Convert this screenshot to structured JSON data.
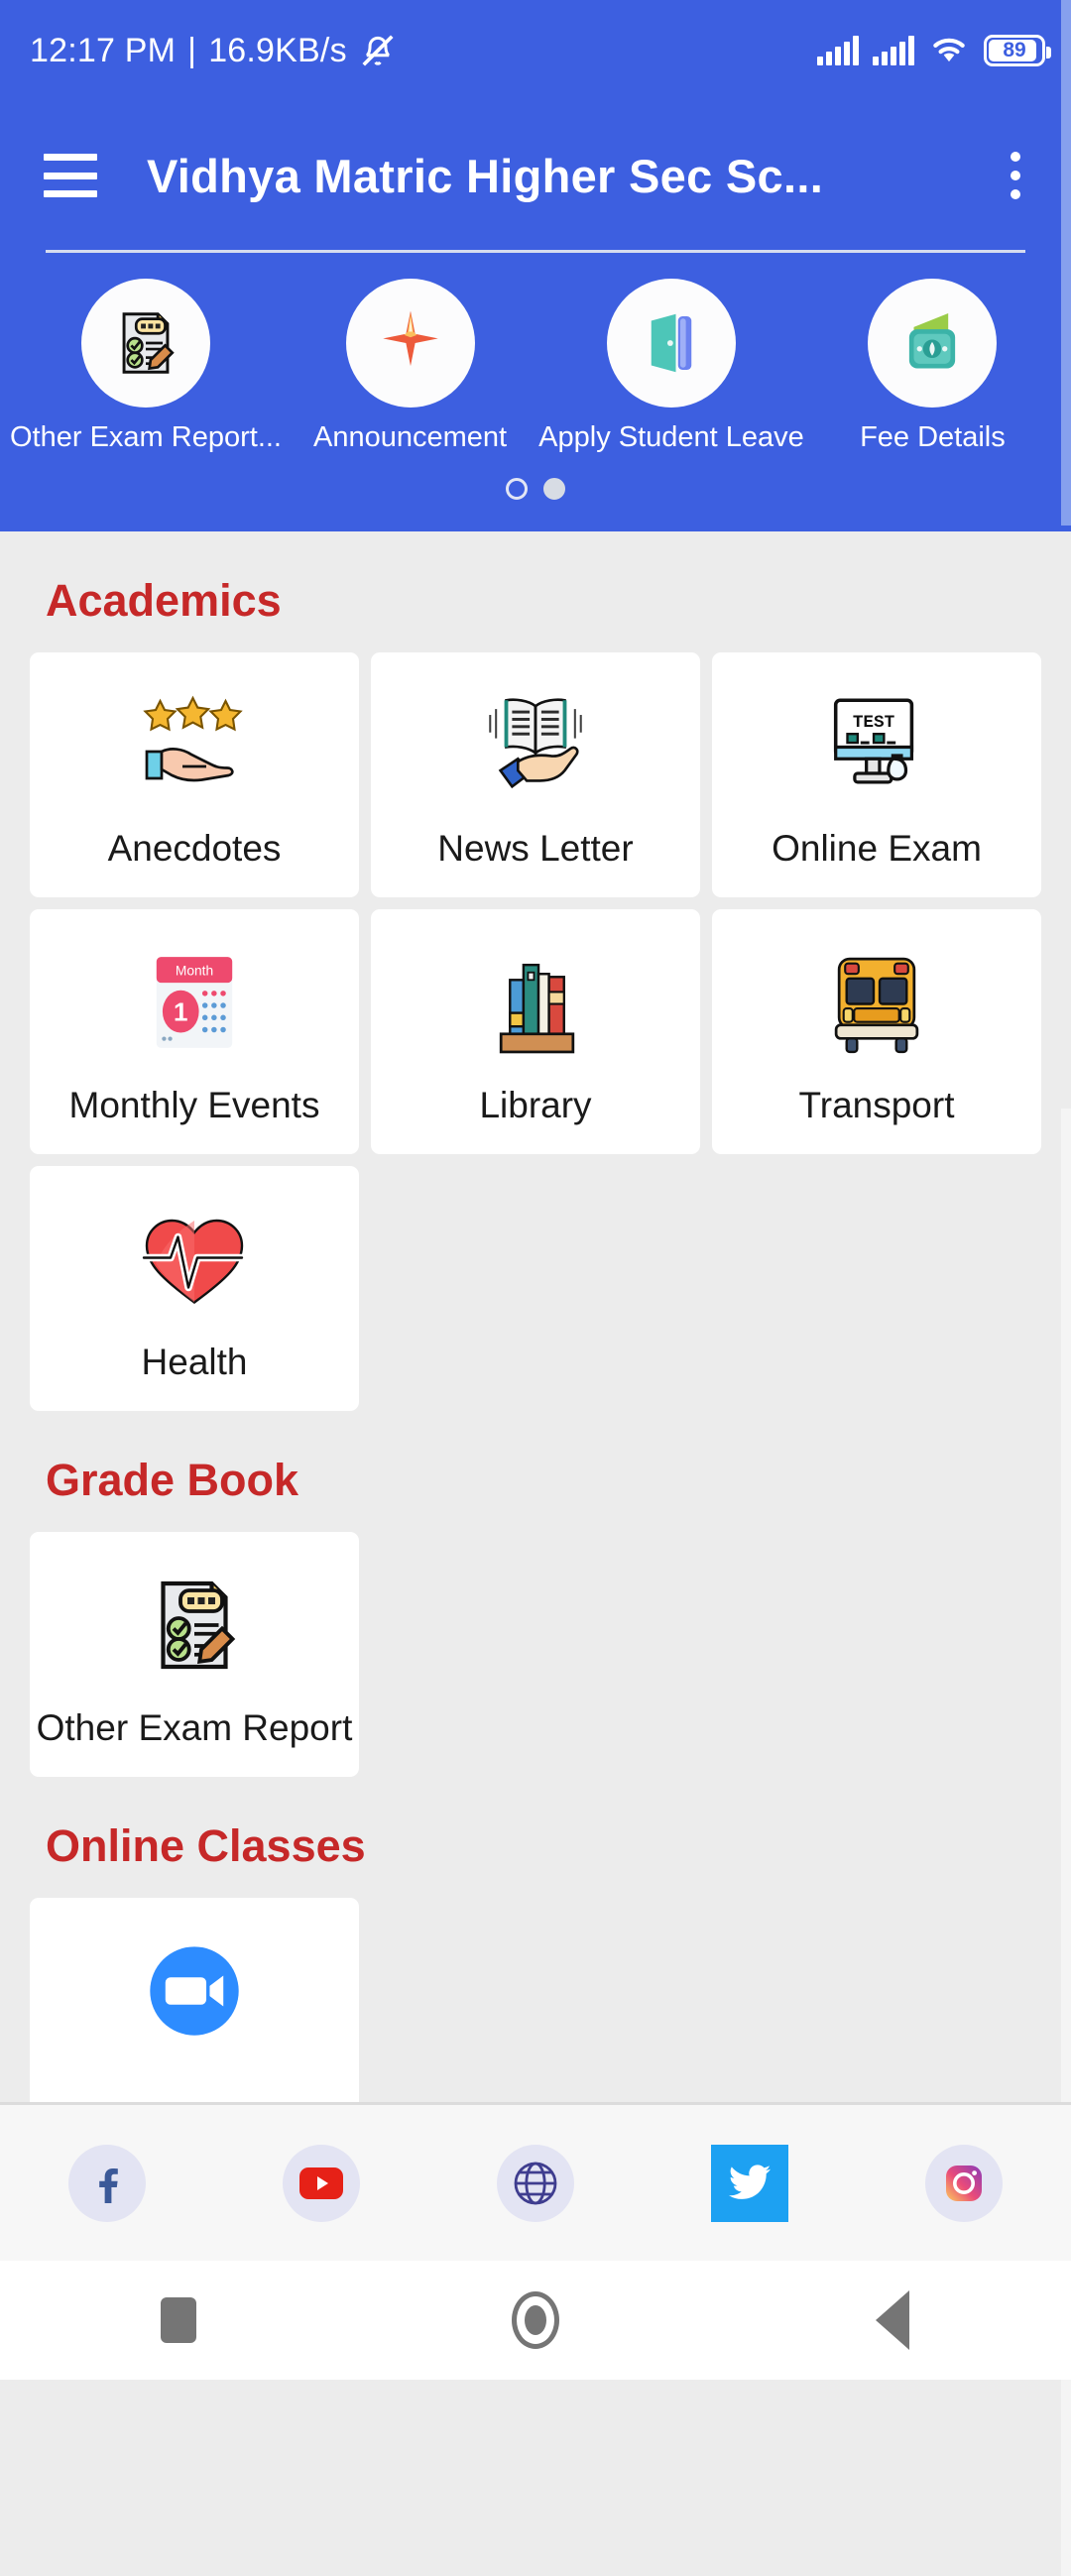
{
  "status_bar": {
    "time": "12:17 PM",
    "separator": "|",
    "network_speed": "16.9KB/s",
    "mute_icon": "bell-muted-icon",
    "signal1_icon": "signal-bars-icon",
    "signal2_icon": "signal-bars-icon",
    "wifi_icon": "wifi-icon",
    "battery_level": "89"
  },
  "app_bar": {
    "menu_icon": "hamburger-menu-icon",
    "title": "Vidhya Matric Higher Sec Sc...",
    "overflow_icon": "kebab-menu-icon"
  },
  "quick_actions": {
    "items": [
      {
        "label": "Other Exam Report...",
        "icon": "exam-report-checklist-icon"
      },
      {
        "label": "Announcement",
        "icon": "star-announcement-icon"
      },
      {
        "label": "Apply Student Leave",
        "icon": "door-exit-icon"
      },
      {
        "label": "Fee Details",
        "icon": "money-wallet-icon"
      }
    ],
    "page_dots": [
      {
        "active": false
      },
      {
        "active": true
      }
    ]
  },
  "sections": [
    {
      "title": "Academics",
      "tiles": [
        {
          "label": "Anecdotes",
          "icon": "stars-hand-icon"
        },
        {
          "label": "News Letter",
          "icon": "open-book-hand-icon"
        },
        {
          "label": "Online Exam",
          "icon": "test-monitor-icon",
          "screen_text": "TEST"
        },
        {
          "label": "Monthly Events",
          "icon": "calendar-icon",
          "calendar_header": "Month",
          "calendar_day": "1"
        },
        {
          "label": "Library",
          "icon": "books-shelf-icon"
        },
        {
          "label": "Transport",
          "icon": "school-bus-icon"
        },
        {
          "label": "Health",
          "icon": "heart-pulse-icon"
        }
      ]
    },
    {
      "title": "Grade Book",
      "tiles": [
        {
          "label": "Other Exam Report",
          "icon": "exam-report-checklist-icon"
        }
      ]
    },
    {
      "title": "Online Classes",
      "tiles": [
        {
          "label": "",
          "icon": "zoom-video-icon"
        }
      ]
    }
  ],
  "social_bar": {
    "items": [
      {
        "name": "facebook",
        "icon": "facebook-icon"
      },
      {
        "name": "youtube",
        "icon": "youtube-icon"
      },
      {
        "name": "website",
        "icon": "globe-icon"
      },
      {
        "name": "twitter",
        "icon": "twitter-icon"
      },
      {
        "name": "instagram",
        "icon": "instagram-icon"
      }
    ]
  },
  "nav_bar": {
    "recents_icon": "square-recents-icon",
    "home_icon": "circle-home-icon",
    "back_icon": "triangle-back-icon"
  },
  "colors": {
    "primary_blue": "#3D5FE0",
    "section_red": "#C62828",
    "background_gray": "#ECECEC",
    "tile_white": "#FFFFFF",
    "twitter_blue": "#1DA1F2",
    "youtube_red": "#E62117"
  }
}
